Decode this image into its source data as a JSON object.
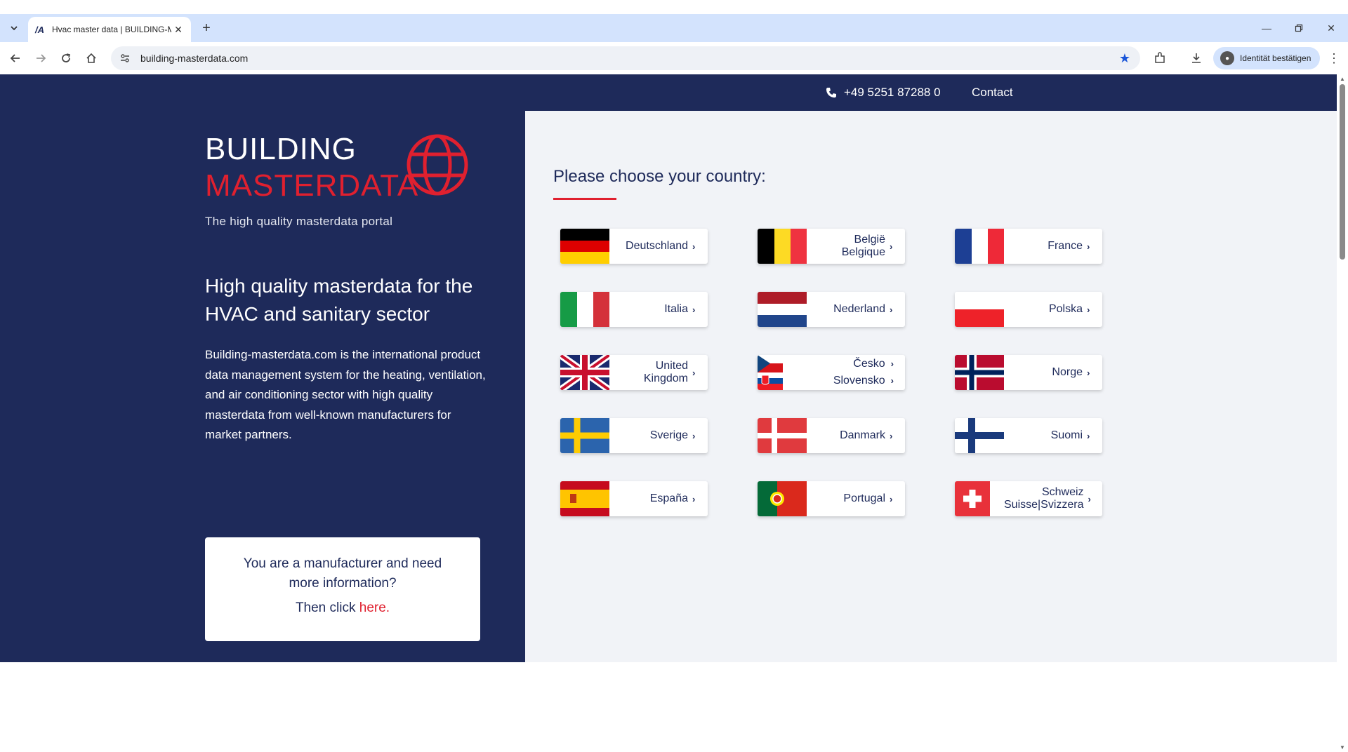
{
  "browser": {
    "tab_title": "Hvac master data | BUILDING-MASTERDATA",
    "tab_favicon": "/A",
    "url": "building-masterdata.com",
    "profile_label": "Identität bestätigen",
    "icons": [
      "tab-list-icon",
      "close-icon",
      "plus-icon",
      "minimize-icon",
      "restore-icon",
      "window-close-icon",
      "back-icon",
      "forward-icon",
      "reload-icon",
      "home-icon",
      "site-info-icon",
      "star-icon",
      "extensions-icon",
      "download-icon",
      "kebab-menu-icon"
    ]
  },
  "header": {
    "phone": "+49 5251 87288 0",
    "contact": "Contact"
  },
  "brand": {
    "line1": "BUILDING",
    "line2": "MASTERDATA",
    "tagline": "The high quality masterdata portal",
    "accent_color": "#e0202f",
    "navy_color": "#1e2a5a"
  },
  "intro": {
    "headline": "High quality masterdata for the HVAC and sanitary sector",
    "body": "Building-masterdata.com is the international product data management system for the heating, ventilation, and air conditioning sector with high quality masterdata from well-known manufacturers for market partners."
  },
  "manufacturer_box": {
    "question": "You are a manufacturer and need more information?",
    "cta_prefix": "Then click ",
    "cta_link": "here."
  },
  "countries": {
    "heading": "Please choose your country:",
    "items": [
      {
        "label": "Deutschland"
      },
      {
        "label": "België",
        "label2": "Belgique"
      },
      {
        "label": "France"
      },
      {
        "label": "Italia"
      },
      {
        "label": "Nederland"
      },
      {
        "label": "Polska"
      },
      {
        "label": "United",
        "label2": "Kingdom"
      },
      {
        "label": "Česko",
        "label2": "Slovensko"
      },
      {
        "label": "Norge"
      },
      {
        "label": "Sverige"
      },
      {
        "label": "Danmark"
      },
      {
        "label": "Suomi"
      },
      {
        "label": "España"
      },
      {
        "label": "Portugal"
      },
      {
        "label": "Schweiz",
        "label2": "Suisse|Svizzera"
      }
    ]
  }
}
